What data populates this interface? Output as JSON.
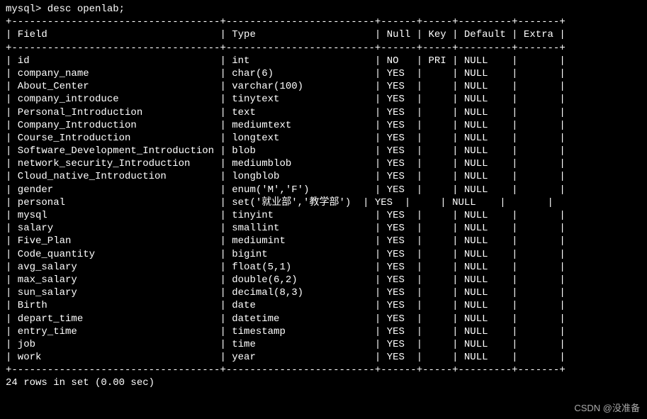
{
  "prompt": "mysql> desc openlab;",
  "separator": "+-----------------------------------+-------------------------+------+-----+---------+-------+",
  "headers": {
    "field": "Field",
    "type": "Type",
    "null": "Null",
    "key": "Key",
    "default": "Default",
    "extra": "Extra"
  },
  "rows": [
    {
      "field": "id",
      "type": "int",
      "null": "NO",
      "key": "PRI",
      "default": "NULL",
      "extra": ""
    },
    {
      "field": "company_name",
      "type": "char(6)",
      "null": "YES",
      "key": "",
      "default": "NULL",
      "extra": ""
    },
    {
      "field": "About_Center",
      "type": "varchar(100)",
      "null": "YES",
      "key": "",
      "default": "NULL",
      "extra": ""
    },
    {
      "field": "company_introduce",
      "type": "tinytext",
      "null": "YES",
      "key": "",
      "default": "NULL",
      "extra": ""
    },
    {
      "field": "Personal_Introduction",
      "type": "text",
      "null": "YES",
      "key": "",
      "default": "NULL",
      "extra": ""
    },
    {
      "field": "Company_Introduction",
      "type": "mediumtext",
      "null": "YES",
      "key": "",
      "default": "NULL",
      "extra": ""
    },
    {
      "field": "Course_Introduction",
      "type": "longtext",
      "null": "YES",
      "key": "",
      "default": "NULL",
      "extra": ""
    },
    {
      "field": "Software_Development_Introduction",
      "type": "blob",
      "null": "YES",
      "key": "",
      "default": "NULL",
      "extra": ""
    },
    {
      "field": "network_security_Introduction",
      "type": "mediumblob",
      "null": "YES",
      "key": "",
      "default": "NULL",
      "extra": ""
    },
    {
      "field": "Cloud_native_Introduction",
      "type": "longblob",
      "null": "YES",
      "key": "",
      "default": "NULL",
      "extra": ""
    },
    {
      "field": "gender",
      "type": "enum('M','F')",
      "null": "YES",
      "key": "",
      "default": "NULL",
      "extra": ""
    },
    {
      "field": "personal",
      "type": "set('就业部','教学部')",
      "null": "YES",
      "key": "",
      "default": "NULL",
      "extra": ""
    },
    {
      "field": "mysql",
      "type": "tinyint",
      "null": "YES",
      "key": "",
      "default": "NULL",
      "extra": ""
    },
    {
      "field": "salary",
      "type": "smallint",
      "null": "YES",
      "key": "",
      "default": "NULL",
      "extra": ""
    },
    {
      "field": "Five_Plan",
      "type": "mediumint",
      "null": "YES",
      "key": "",
      "default": "NULL",
      "extra": ""
    },
    {
      "field": "Code_quantity",
      "type": "bigint",
      "null": "YES",
      "key": "",
      "default": "NULL",
      "extra": ""
    },
    {
      "field": "avg_salary",
      "type": "float(5,1)",
      "null": "YES",
      "key": "",
      "default": "NULL",
      "extra": ""
    },
    {
      "field": "max_salary",
      "type": "double(6,2)",
      "null": "YES",
      "key": "",
      "default": "NULL",
      "extra": ""
    },
    {
      "field": "sun_salary",
      "type": "decimal(8,3)",
      "null": "YES",
      "key": "",
      "default": "NULL",
      "extra": ""
    },
    {
      "field": "Birth",
      "type": "date",
      "null": "YES",
      "key": "",
      "default": "NULL",
      "extra": ""
    },
    {
      "field": "depart_time",
      "type": "datetime",
      "null": "YES",
      "key": "",
      "default": "NULL",
      "extra": ""
    },
    {
      "field": "entry_time",
      "type": "timestamp",
      "null": "YES",
      "key": "",
      "default": "NULL",
      "extra": ""
    },
    {
      "field": "job",
      "type": "time",
      "null": "YES",
      "key": "",
      "default": "NULL",
      "extra": ""
    },
    {
      "field": "work",
      "type": "year",
      "null": "YES",
      "key": "",
      "default": "NULL",
      "extra": ""
    }
  ],
  "footer": "24 rows in set (0.00 sec)",
  "watermark": "CSDN @没准备",
  "col_widths": {
    "field": 33,
    "type": 23,
    "null": 4,
    "key": 3,
    "default": 7,
    "extra": 5
  }
}
